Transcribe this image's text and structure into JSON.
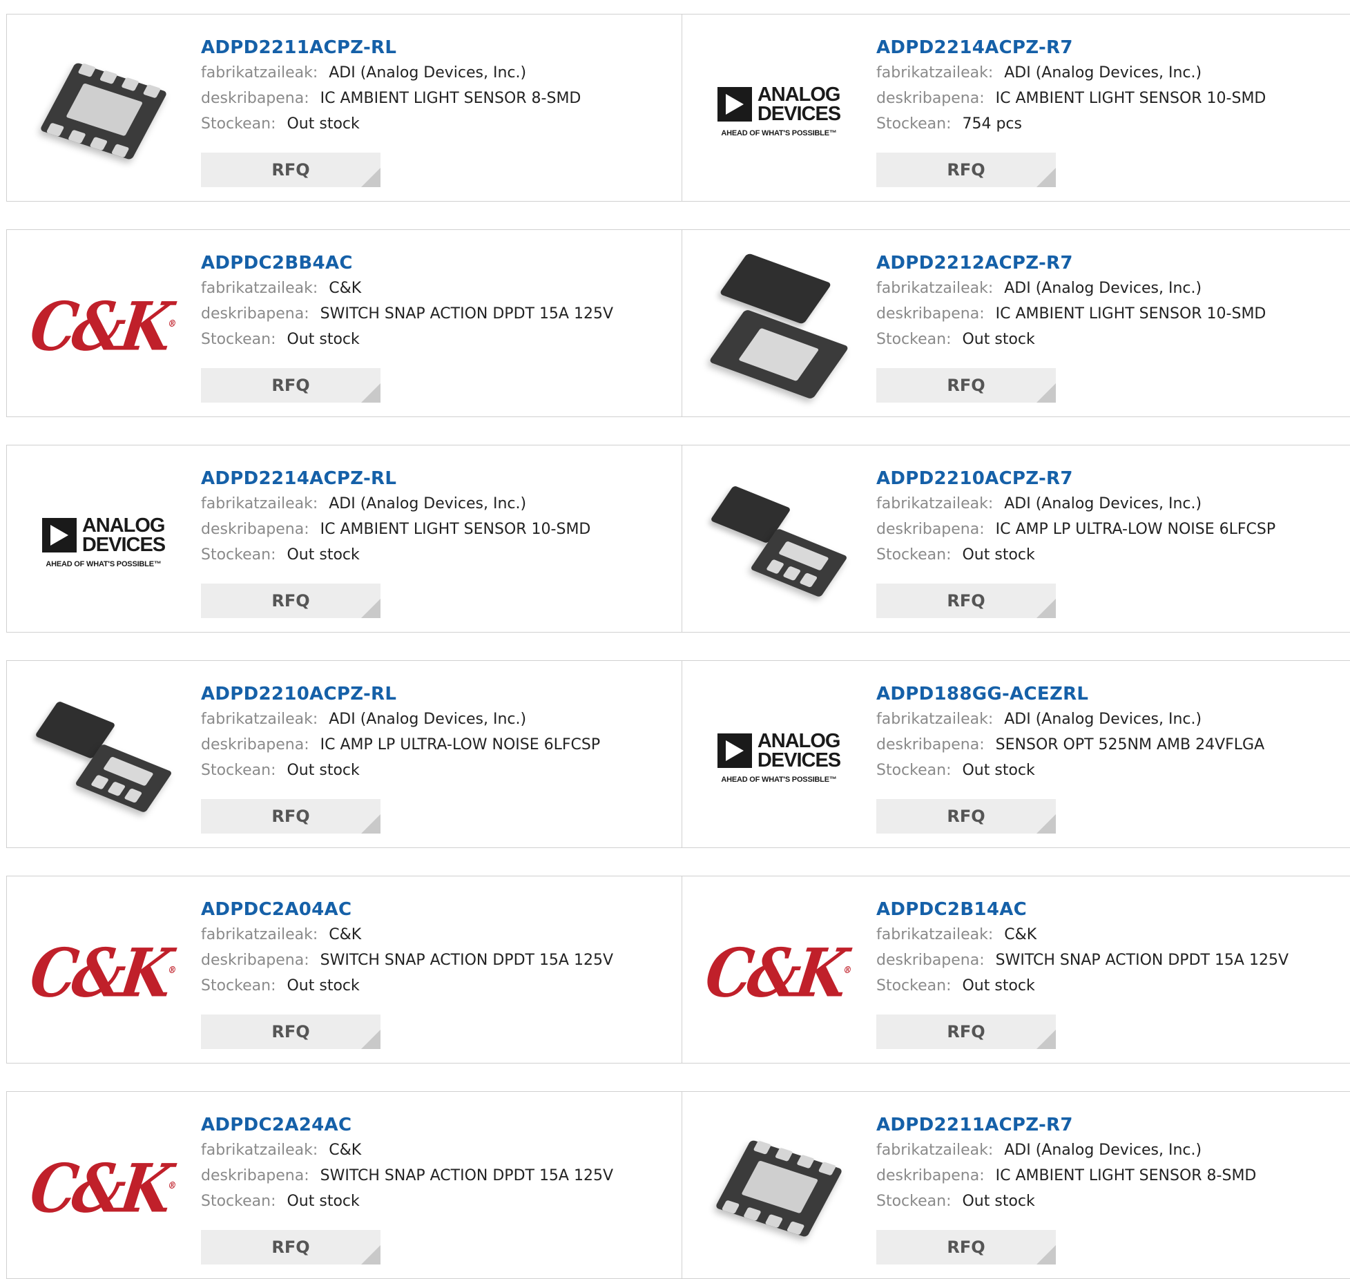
{
  "labels": {
    "manufacturer": "fabrikatzaileak:",
    "description": "deskribapena:",
    "stock": "Stockean:",
    "rfq": "RFQ"
  },
  "colors": {
    "link": "#1560a8",
    "border": "#d0d0d0",
    "rfq_bg": "#ededed",
    "ck_red": "#c0202a"
  },
  "products": [
    {
      "part": "ADPD2211ACPZ-RL",
      "manufacturer": "ADI (Analog Devices, Inc.)",
      "description": "IC AMBIENT LIGHT SENSOR 8-SMD",
      "stock": "Out stock",
      "image": "chip-8smd-icon"
    },
    {
      "part": "ADPD2214ACPZ-R7",
      "manufacturer": "ADI (Analog Devices, Inc.)",
      "description": "IC AMBIENT LIGHT SENSOR 10-SMD",
      "stock": "754 pcs",
      "image": "analog-devices-logo"
    },
    {
      "part": "ADPDC2BB4AC",
      "manufacturer": "C&K",
      "description": "SWITCH SNAP ACTION DPDT 15A 125V",
      "stock": "Out stock",
      "image": "ck-logo"
    },
    {
      "part": "ADPD2212ACPZ-R7",
      "manufacturer": "ADI (Analog Devices, Inc.)",
      "description": "IC AMBIENT LIGHT SENSOR 10-SMD",
      "stock": "Out stock",
      "image": "chip-10smd-icon"
    },
    {
      "part": "ADPD2214ACPZ-RL",
      "manufacturer": "ADI (Analog Devices, Inc.)",
      "description": "IC AMBIENT LIGHT SENSOR 10-SMD",
      "stock": "Out stock",
      "image": "analog-devices-logo"
    },
    {
      "part": "ADPD2210ACPZ-R7",
      "manufacturer": "ADI (Analog Devices, Inc.)",
      "description": "IC AMP LP ULTRA-LOW NOISE 6LFCSP",
      "stock": "Out stock",
      "image": "chip-6lfcsp-icon"
    },
    {
      "part": "ADPD2210ACPZ-RL",
      "manufacturer": "ADI (Analog Devices, Inc.)",
      "description": "IC AMP LP ULTRA-LOW NOISE 6LFCSP",
      "stock": "Out stock",
      "image": "chip-6lfcsp-icon"
    },
    {
      "part": "ADPD188GG-ACEZRL",
      "manufacturer": "ADI (Analog Devices, Inc.)",
      "description": "SENSOR OPT 525NM AMB 24VFLGA",
      "stock": "Out stock",
      "image": "analog-devices-logo"
    },
    {
      "part": "ADPDC2A04AC",
      "manufacturer": "C&K",
      "description": "SWITCH SNAP ACTION DPDT 15A 125V",
      "stock": "Out stock",
      "image": "ck-logo"
    },
    {
      "part": "ADPDC2B14AC",
      "manufacturer": "C&K",
      "description": "SWITCH SNAP ACTION DPDT 15A 125V",
      "stock": "Out stock",
      "image": "ck-logo"
    },
    {
      "part": "ADPDC2A24AC",
      "manufacturer": "C&K",
      "description": "SWITCH SNAP ACTION DPDT 15A 125V",
      "stock": "Out stock",
      "image": "ck-logo"
    },
    {
      "part": "ADPD2211ACPZ-R7",
      "manufacturer": "ADI (Analog Devices, Inc.)",
      "description": "IC AMBIENT LIGHT SENSOR 8-SMD",
      "stock": "Out stock",
      "image": "chip-8smd-icon"
    }
  ],
  "logos": {
    "ck": "C&K",
    "adi_line1": "ANALOG",
    "adi_line2": "DEVICES",
    "adi_tagline": "AHEAD OF WHAT'S POSSIBLE™"
  }
}
